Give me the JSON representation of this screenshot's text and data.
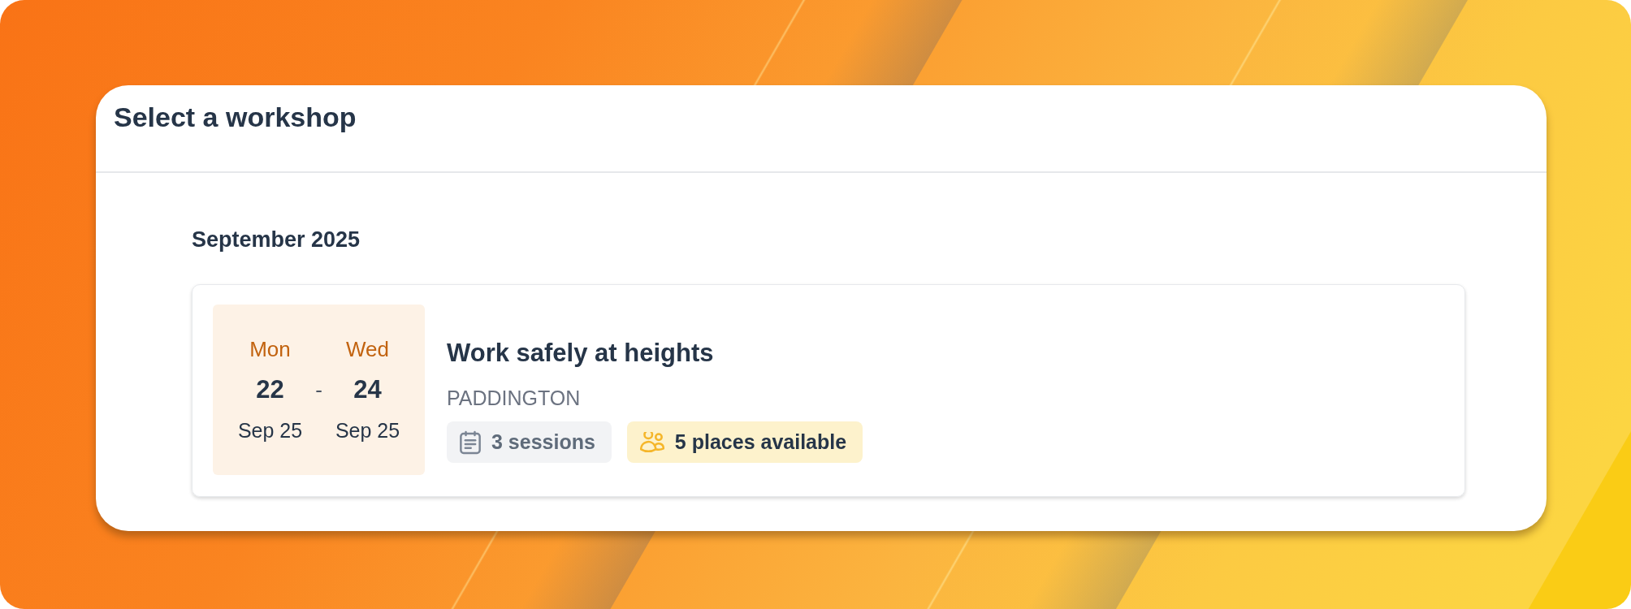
{
  "dialog": {
    "title": "Select a workshop"
  },
  "sections": [
    {
      "heading": "September 2025",
      "workshops": [
        {
          "start": {
            "weekday": "Mon",
            "day": "22",
            "month_year": "Sep 25"
          },
          "separator": "-",
          "end": {
            "weekday": "Wed",
            "day": "24",
            "month_year": "Sep 25"
          },
          "title": "Work safely at heights",
          "location": "PADDINGTON",
          "badges": [
            {
              "kind": "sessions",
              "label": "3 sessions"
            },
            {
              "kind": "places",
              "label": "5 places available"
            }
          ]
        }
      ]
    }
  ]
}
